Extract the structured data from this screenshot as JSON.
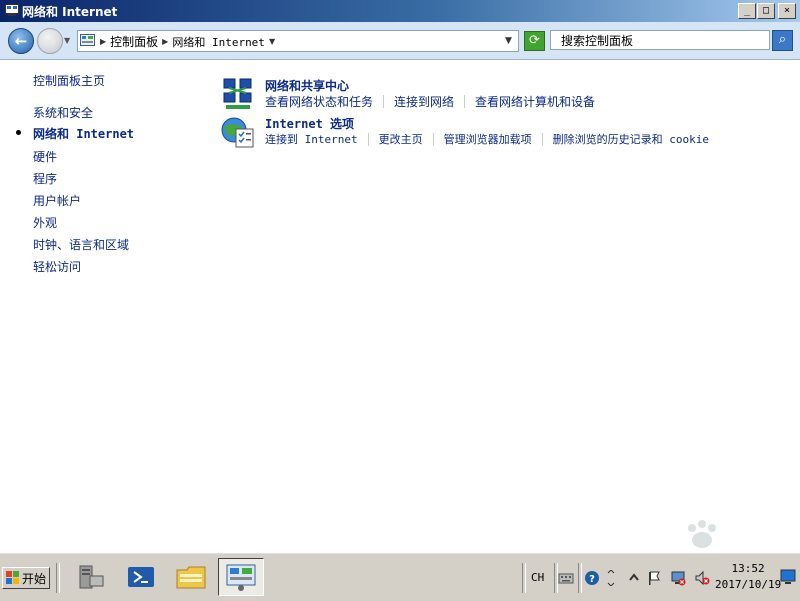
{
  "window": {
    "title": "网络和 Internet"
  },
  "titlebar": {
    "minimize": "_",
    "maximize": "□",
    "close": "×"
  },
  "address": {
    "crumbs": [
      "控制面板",
      "网络和 Internet"
    ],
    "search_placeholder": "搜索控制面板"
  },
  "sidebar": {
    "items": [
      {
        "label": "控制面板主页"
      },
      {
        "label": "系统和安全"
      },
      {
        "label": "网络和 Internet",
        "current": true
      },
      {
        "label": "硬件"
      },
      {
        "label": "程序"
      },
      {
        "label": "用户帐户"
      },
      {
        "label": "外观"
      },
      {
        "label": "时钟、语言和区域"
      },
      {
        "label": "轻松访问"
      }
    ]
  },
  "categories": [
    {
      "title": "网络和共享中心",
      "icon": "network-sharing-icon",
      "links": [
        "查看网络状态和任务",
        "连接到网络",
        "查看网络计算机和设备"
      ]
    },
    {
      "title": "Internet 选项",
      "icon": "internet-options-icon",
      "links": [
        "连接到 Internet",
        "更改主页",
        "管理浏览器加载项",
        "删除浏览的历史记录和 cookie"
      ]
    }
  ],
  "taskbar": {
    "start_label": "开始",
    "apps": [
      "server-manager-icon",
      "powershell-icon",
      "explorer-icon",
      "control-panel-icon"
    ],
    "tray": {
      "lang": "CH",
      "time": "13:52",
      "date": "2017/10/19"
    }
  },
  "colors": {
    "link": "#0b2a8a",
    "titlebar": "#0a246a",
    "taskbar": "#d4d0c8"
  }
}
